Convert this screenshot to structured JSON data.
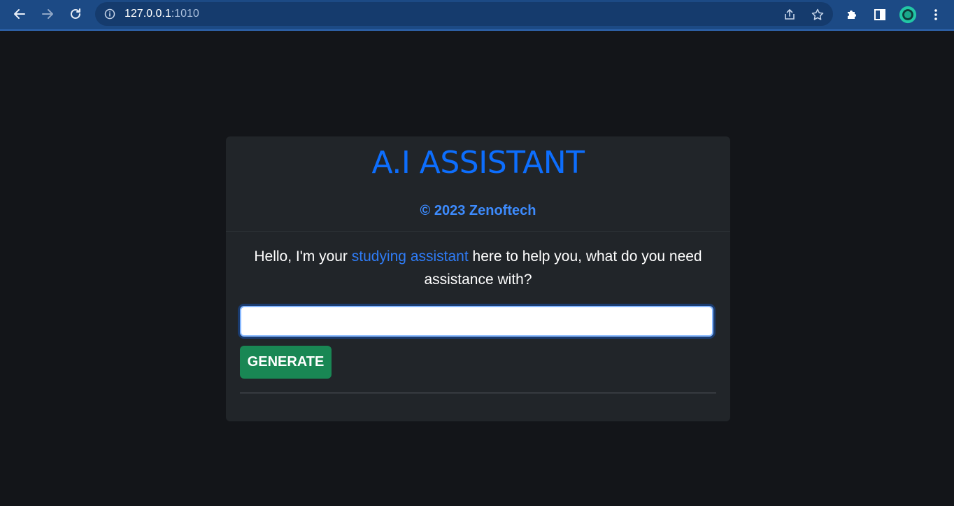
{
  "browser": {
    "url_host": "127.0.0.1",
    "url_port": ":1010",
    "icons": {
      "back": "back-arrow-icon",
      "forward": "forward-arrow-icon",
      "reload": "reload-icon",
      "info": "info-icon",
      "share": "share-icon",
      "bookmark": "star-icon",
      "extensions": "puzzle-icon",
      "sidepanel": "side-panel-icon",
      "profile": "profile-avatar-icon",
      "menu": "kebab-menu-icon"
    }
  },
  "card": {
    "title": "A.I ASSISTANT",
    "subtitle": "© 2023 Zenoftech",
    "intro_before": "Hello, I'm your ",
    "intro_highlight": "studying assistant",
    "intro_after": " here to help you, what do you need assistance with?",
    "input_value": "",
    "generate_label": "GENERATE"
  },
  "colors": {
    "page_bg": "#131519",
    "card_bg": "#212529",
    "title": "#0d6efd",
    "subtitle": "#3d8bfd",
    "button": "#198754",
    "chrome": "#1c4a85"
  }
}
